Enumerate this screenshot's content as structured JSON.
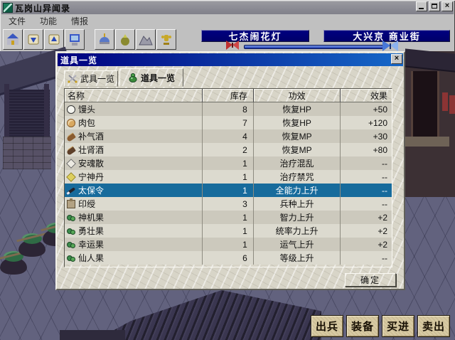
{
  "window": {
    "title": "瓦岗山异闻录",
    "controls": [
      "minimize",
      "maximize",
      "close"
    ]
  },
  "menu": {
    "items": [
      {
        "label": "文件"
      },
      {
        "label": "功能"
      },
      {
        "label": "情报"
      }
    ]
  },
  "toolbar": {
    "buttons": [
      "castle",
      "scroll-down",
      "scroll-up",
      "computer",
      "helmet",
      "money-bag",
      "mountain",
      "trophy"
    ]
  },
  "banners": {
    "event": "七杰闹花灯",
    "location": "大兴京  商业街"
  },
  "dialog": {
    "title": "道具一览",
    "close_glyph": "×",
    "tabs": [
      {
        "label": "武具一览",
        "icon": "crossed-swords",
        "active": false
      },
      {
        "label": "道具一览",
        "icon": "gourd",
        "active": true
      }
    ],
    "table": {
      "columns": [
        "名称",
        "库存",
        "功效",
        "效果"
      ],
      "rows": [
        {
          "icon": "steamed-bun",
          "name": "馒头",
          "stock": "8",
          "effect": "恢复HP",
          "value": "+50",
          "selected": false
        },
        {
          "icon": "meat-bun",
          "name": "肉包",
          "stock": "7",
          "effect": "恢复HP",
          "value": "+120",
          "selected": false
        },
        {
          "icon": "wine-bottle",
          "name": "补气酒",
          "stock": "4",
          "effect": "恢复MP",
          "value": "+30",
          "selected": false
        },
        {
          "icon": "wine-bottle",
          "name": "壮肾酒",
          "stock": "2",
          "effect": "恢复MP",
          "value": "+80",
          "selected": false
        },
        {
          "icon": "powder",
          "name": "安魂散",
          "stock": "1",
          "effect": "治疗混乱",
          "value": "--",
          "selected": false
        },
        {
          "icon": "pill",
          "name": "宁神丹",
          "stock": "1",
          "effect": "治疗禁咒",
          "value": "--",
          "selected": false
        },
        {
          "icon": "brush-token",
          "name": "太保令",
          "stock": "1",
          "effect": "全能力上升",
          "value": "--",
          "selected": true
        },
        {
          "icon": "seal",
          "name": "印绶",
          "stock": "3",
          "effect": "兵种上升",
          "value": "--",
          "selected": false
        },
        {
          "icon": "fruit",
          "name": "神机果",
          "stock": "1",
          "effect": "智力上升",
          "value": "+2",
          "selected": false
        },
        {
          "icon": "fruit",
          "name": "勇壮果",
          "stock": "1",
          "effect": "统率力上升",
          "value": "+2",
          "selected": false
        },
        {
          "icon": "fruit",
          "name": "幸运果",
          "stock": "1",
          "effect": "运气上升",
          "value": "+2",
          "selected": false
        },
        {
          "icon": "fruit",
          "name": "仙人果",
          "stock": "6",
          "effect": "等级上升",
          "value": "--",
          "selected": false
        }
      ]
    },
    "ok_label": "确定"
  },
  "actions": [
    {
      "label": "出兵"
    },
    {
      "label": "装备"
    },
    {
      "label": "买进"
    },
    {
      "label": "卖出"
    }
  ],
  "colors": {
    "chrome": "#c0c0c0",
    "banner_navy": "#000080",
    "dialog_title_start": "#00007e",
    "dialog_title_end": "#1668c8",
    "selection_blue": "#176b9c",
    "button_tan": "#d7c9a2",
    "scene_base": "#62627e"
  }
}
